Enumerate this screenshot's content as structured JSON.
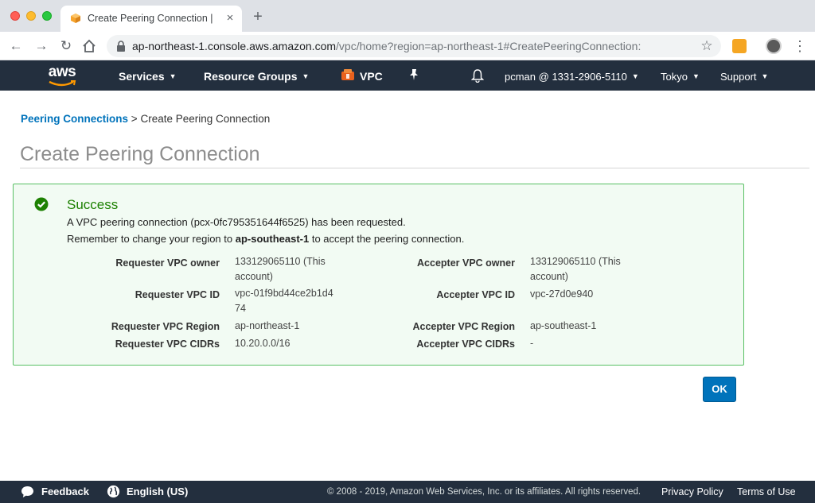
{
  "browser": {
    "tab_title": "Create Peering Connection | VPC Management Console",
    "tab_close": "×",
    "new_tab": "+",
    "url_host": "ap-northeast-1.console.aws.amazon.com",
    "url_path": "/vpc/home?region=ap-northeast-1#CreatePeeringConnection:",
    "icons": [
      "back-icon",
      "forward-icon",
      "reload-icon",
      "home-icon",
      "lock-icon",
      "star-icon",
      "extension-icon",
      "profile-icon",
      "kebab-menu-icon"
    ]
  },
  "awsnav": {
    "logo": "aws",
    "services": "Services",
    "resource_groups": "Resource Groups",
    "vpc": "VPC",
    "account": "pcman @ 1331-2906-5110",
    "region": "Tokyo",
    "support": "Support",
    "bg_color": "#232f3e"
  },
  "breadcrumb": {
    "link": "Peering Connections",
    "separator": ">",
    "current": "Create Peering Connection"
  },
  "page": {
    "title": "Create Peering Connection"
  },
  "success": {
    "title": "Success",
    "line1": "A VPC peering connection (pcx-0fc795351644f6525) has been requested.",
    "line2_prefix": "Remember to change your region to",
    "line2_region": "ap-southeast-1",
    "line2_suffix": "to accept the peering connection.",
    "color": "#1d8102"
  },
  "details": {
    "requester_owner_label": "Requester VPC owner",
    "requester_owner_value": "133129065110 (This account)",
    "requester_id_label": "Requester VPC ID",
    "requester_id_value": "vpc-01f9bd44ce2b1d474",
    "requester_region_label": "Requester VPC Region",
    "requester_region_value": "ap-northeast-1",
    "requester_cidrs_label": "Requester VPC CIDRs",
    "requester_cidrs_value": "10.20.0.0/16",
    "accepter_owner_label": "Accepter VPC owner",
    "accepter_owner_value": "133129065110 (This account)",
    "accepter_id_label": "Accepter VPC ID",
    "accepter_id_value": "vpc-27d0e940",
    "accepter_region_label": "Accepter VPC Region",
    "accepter_region_value": "ap-southeast-1",
    "accepter_cidrs_label": "Accepter VPC CIDRs",
    "accepter_cidrs_value": "-"
  },
  "ok_button": "OK",
  "footer": {
    "feedback": "Feedback",
    "language": "English (US)",
    "copyright": "© 2008 - 2019, Amazon Web Services, Inc. or its affiliates. All rights reserved.",
    "privacy": "Privacy Policy",
    "terms": "Terms of Use"
  }
}
